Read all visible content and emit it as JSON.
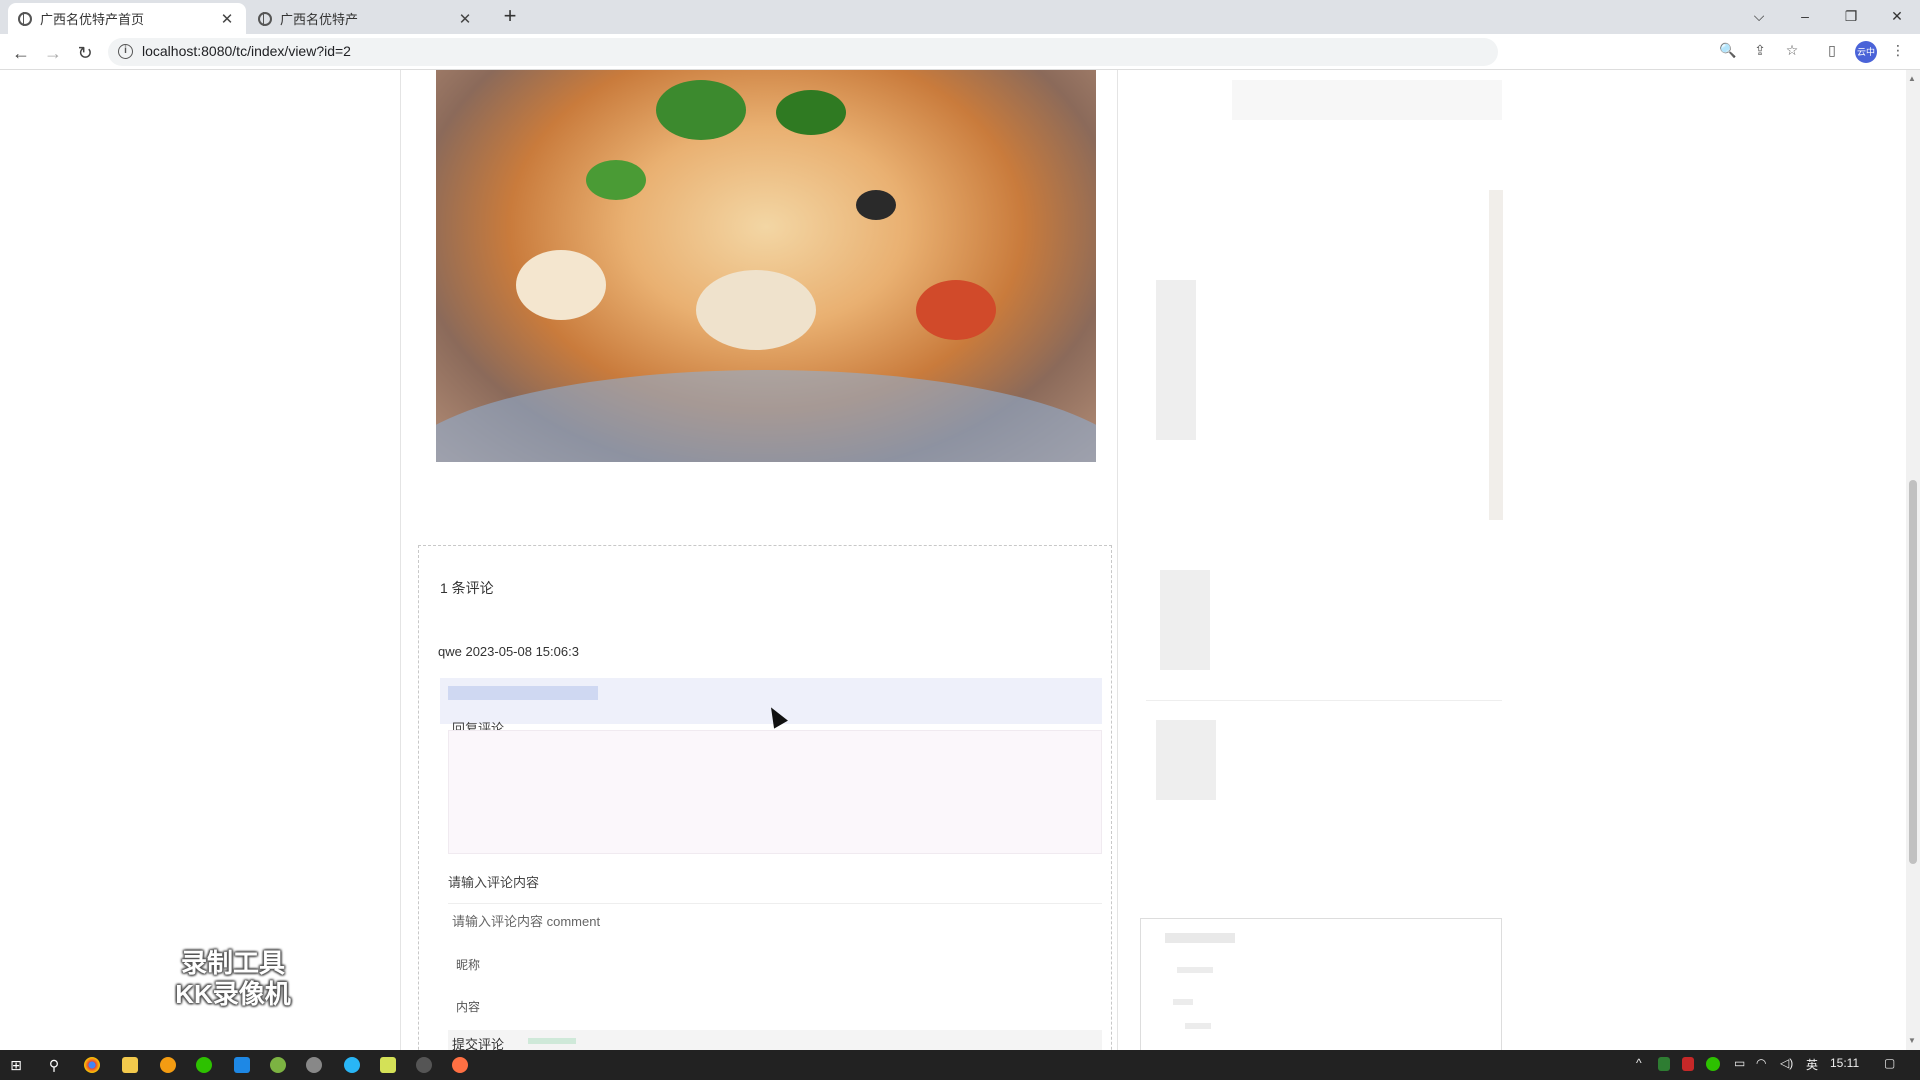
{
  "browser": {
    "tabs": [
      {
        "title": "广西名优特产首页",
        "active": true
      },
      {
        "title": "广西名优特产",
        "active": false
      }
    ],
    "url": "localhost:8080/tc/index/view?id=2",
    "new_tab": "+",
    "profile_label": "云中",
    "win_minimize": "–",
    "win_restore": "❐",
    "win_close": "✕",
    "tab_list": "⌵",
    "tab_close": "✕"
  },
  "nav": {
    "back": "←",
    "forward": "→",
    "reload": "↻"
  },
  "omnibox_icons": {
    "zoom": "🔍",
    "share": "⇪",
    "bookmark": "☆",
    "sidebar": "▯",
    "menu": "⋮"
  },
  "comments": {
    "count_label": "1 条评论",
    "meta": "qwe 2023-05-08 15:06:3",
    "reply_text": "回复评论",
    "input_label": "请输入评论内容",
    "placeholder": "请输入评论内容  comment",
    "tiny_a": "昵称",
    "tiny_b": "内容",
    "form_label": "提交评论",
    "submit_text": "comment"
  },
  "watermark": {
    "line1": "录制工具",
    "line2": "KK录像机"
  },
  "taskbar": {
    "time": "15:11",
    "ime": "英",
    "start": "⊞",
    "search": "⚲"
  },
  "colors": {
    "accent_blue": "#4a63d8",
    "taskbar": "#222222",
    "tab_bg": "#dee1e6"
  }
}
